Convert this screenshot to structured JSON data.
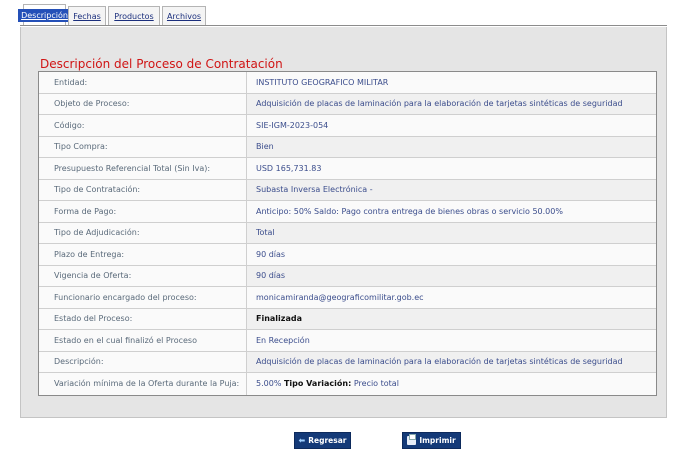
{
  "tabs": [
    {
      "label": "Descripción"
    },
    {
      "label": "Fechas"
    },
    {
      "label": "Productos"
    },
    {
      "label": "Archivos"
    }
  ],
  "section_title": "Descripción del Proceso de Contratación",
  "rows": [
    {
      "label": "Entidad:",
      "value": "INSTITUTO GEOGRAFICO MILITAR"
    },
    {
      "label": "Objeto de Proceso:",
      "value": "Adquisición de placas de laminación para la elaboración de tarjetas sintéticas de seguridad"
    },
    {
      "label": "Código:",
      "value": "SIE-IGM-2023-054"
    },
    {
      "label": "Tipo Compra:",
      "value": "Bien"
    },
    {
      "label": "Presupuesto Referencial Total (Sin Iva):",
      "value": "USD 165,731.83"
    },
    {
      "label": "Tipo de Contratación:",
      "value": "Subasta Inversa Electrónica -"
    },
    {
      "label": "Forma de Pago:",
      "value": "Anticipo: 50% Saldo: Pago contra entrega de bienes obras o servicio 50.00%"
    },
    {
      "label": "Tipo de Adjudicación:",
      "value": "Total"
    },
    {
      "label": "Plazo de Entrega:",
      "value": "90 días"
    },
    {
      "label": "Vigencia de Oferta:",
      "value": "90 días"
    },
    {
      "label": "Funcionario encargado del proceso:",
      "value": "monicamiranda@geograficomilitar.gob.ec"
    },
    {
      "label": "Estado del Proceso:",
      "value": "Finalizada"
    },
    {
      "label": "Estado en el cual finalizó el Proceso",
      "value": "En Recepción"
    },
    {
      "label": "Descripción:",
      "value": "Adquisición de placas de laminación para la elaboración de tarjetas sintéticas de seguridad"
    },
    {
      "label": "Variación mínima de la Oferta durante la Puja:",
      "value_prefix": "5.00%",
      "value_bold": "Tipo Variación:",
      "value_suffix": "Precio total"
    }
  ],
  "buttons": {
    "back": {
      "label": "Regresar",
      "icon": "back-arrow-icon"
    },
    "print": {
      "label": "Imprimir",
      "icon": "printer-icon"
    }
  }
}
